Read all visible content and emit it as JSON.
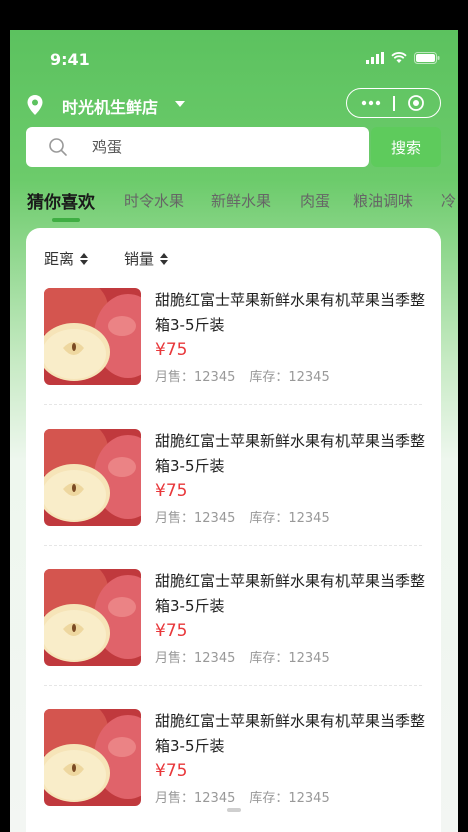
{
  "status_bar": {
    "time": "9:41"
  },
  "store": {
    "name": "时光机生鲜店"
  },
  "search": {
    "placeholder": "鸡蛋",
    "button_label": "搜索"
  },
  "tabs": [
    "猜你喜欢",
    "时令水果",
    "新鲜水果",
    "肉蛋",
    "粮油调味",
    "冷"
  ],
  "sort": {
    "distance_label": "距离",
    "sales_label": "销量"
  },
  "products": [
    {
      "title": "甜脆红富士苹果新鲜水果有机苹果当季整箱3-5斤装",
      "price": "¥75",
      "monthly_sales": "月售：12345",
      "stock": "库存：12345"
    },
    {
      "title": "甜脆红富士苹果新鲜水果有机苹果当季整箱3-5斤装",
      "price": "¥75",
      "monthly_sales": "月售：12345",
      "stock": "库存：12345"
    },
    {
      "title": "甜脆红富士苹果新鲜水果有机苹果当季整箱3-5斤装",
      "price": "¥75",
      "monthly_sales": "月售：12345",
      "stock": "库存：12345"
    },
    {
      "title": "甜脆红富士苹果新鲜水果有机苹果当季整箱3-5斤装",
      "price": "¥75",
      "monthly_sales": "月售：12345",
      "stock": "库存：12345"
    }
  ],
  "colors": {
    "brand_green": "#5cc25f",
    "search_button": "#5ecb5c",
    "price_red": "#e8383b",
    "tab_indicator": "#3fae43"
  },
  "icons": [
    "location-pin-icon",
    "caret-down-icon",
    "more-dots-icon",
    "target-icon",
    "search-icon",
    "signal-icon",
    "wifi-icon",
    "battery-icon",
    "sort-arrows-icon"
  ]
}
